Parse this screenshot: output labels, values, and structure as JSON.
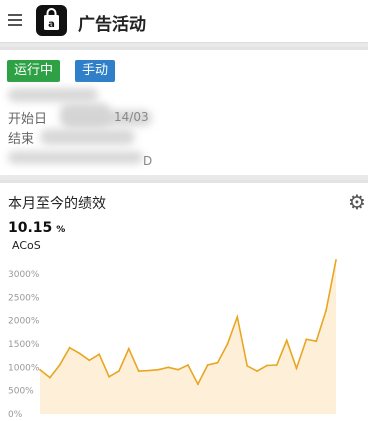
{
  "header": {
    "menu_icon": "hamburger-menu-icon",
    "app_icon": "shopping-bag-icon",
    "title": "广告活动"
  },
  "campaign": {
    "status_badge": "运行中",
    "type_badge": "手动",
    "status_color": "#2ea145",
    "type_color": "#2f80c8",
    "start_label": "开始日",
    "start_value_fragment": "14/03",
    "end_label": "结束",
    "budget_fragment": "D"
  },
  "performance": {
    "title": "本月至今的绩效",
    "settings_icon": "gear-icon",
    "metric_value": "10.15",
    "metric_unit": "%",
    "metric_name": "ACoS"
  },
  "chart_data": {
    "type": "area",
    "yticks": [
      "3000%",
      "2500%",
      "2000%",
      "1500%",
      "1000%",
      "500%",
      "0%"
    ],
    "ylim": [
      0,
      3200
    ],
    "line_color": "#e8a623",
    "fill_color": "#fde9c8",
    "values": [
      950,
      780,
      1050,
      1420,
      1300,
      1150,
      1280,
      800,
      920,
      1400,
      920,
      930,
      950,
      1000,
      950,
      1050,
      640,
      1050,
      1100,
      1500,
      2080,
      1030,
      920,
      1040,
      1050,
      1580,
      980,
      1600,
      1560,
      2220,
      3300
    ]
  }
}
